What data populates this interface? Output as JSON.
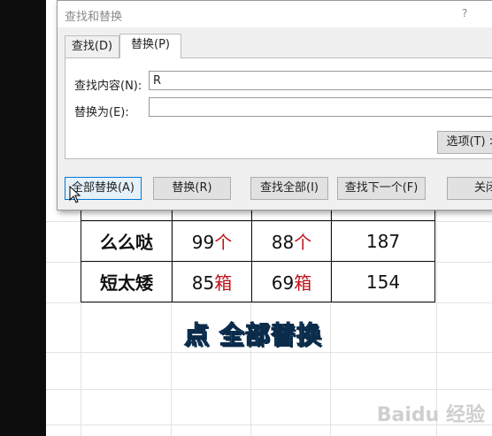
{
  "dialog": {
    "title": "查找和替换",
    "help": "?",
    "tabs": [
      {
        "label": "查找(D)"
      },
      {
        "label": "替换(P)"
      }
    ],
    "find_label": "查找内容(N):",
    "find_value": "R",
    "replace_label": "替换为(E):",
    "replace_value": "",
    "options_label": "选项(T) >",
    "buttons": {
      "replace_all": "全部替换(A)",
      "replace": "替换(R)",
      "find_all": "查找全部(I)",
      "find_next": "查找下一个(F)",
      "close": "关闭"
    }
  },
  "table": {
    "rows": [
      {
        "name": "么么哒",
        "v1": "99",
        "u1": "个",
        "v2": "88",
        "u2": "个",
        "total": "187"
      },
      {
        "name": "短太矮",
        "v1": "85",
        "u1": "箱",
        "v2": "69",
        "u2": "箱",
        "total": "154"
      }
    ]
  },
  "caption": "点 全部替换",
  "watermark": "Baidu 经验",
  "colors": {
    "accent": "#0078d7",
    "red_text": "#c0121a",
    "caption": "#25a9f0"
  }
}
